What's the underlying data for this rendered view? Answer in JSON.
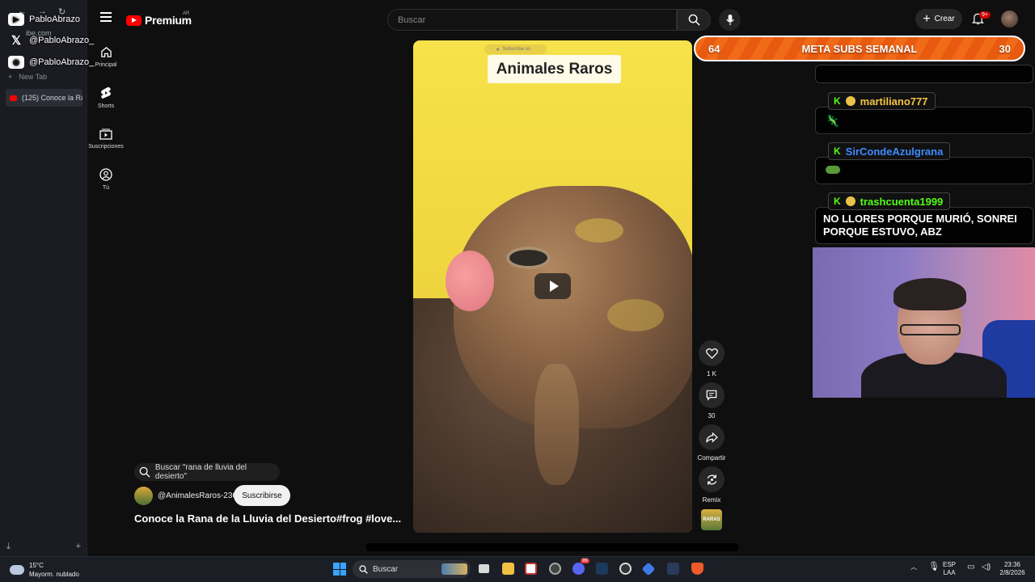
{
  "browser": {
    "url_fragment": "ibe.com",
    "new_tab_label": "New Tab",
    "active_tab_title": "(125) Conoce la Ra"
  },
  "socials": [
    {
      "platform": "youtube",
      "handle": "PabloAbrazo"
    },
    {
      "platform": "x",
      "handle": "@PabloAbrazo_"
    },
    {
      "platform": "discord",
      "handle": "@PabloAbrazo_"
    }
  ],
  "youtube": {
    "logo_text": "Premium",
    "region": "AR",
    "search_placeholder": "Buscar",
    "create_label": "Crear",
    "notification_badge": "9+",
    "nav": [
      {
        "label": "Principal",
        "icon": "home-icon"
      },
      {
        "label": "Shorts",
        "icon": "shorts-icon"
      },
      {
        "label": "Suscripciones",
        "icon": "subscriptions-icon"
      },
      {
        "label": "Tú",
        "icon": "you-icon"
      }
    ]
  },
  "short": {
    "overlay_subscribe": "Subscribe us",
    "overlay_title": "Animales Raros",
    "actions": {
      "like_count": "1 K",
      "comment_count": "30",
      "share_label": "Compartir",
      "remix_label": "Remix"
    },
    "channel_thumb_text": "RARAS",
    "related_search": "Buscar \"rana de lluvia del desierto\"",
    "channel_name": "@AnimalesRaros-236",
    "subscribe_label": "Suscribirse",
    "title": "Conoce la Rana de la Lluvia del Desierto#frog #love..."
  },
  "stream": {
    "goal": {
      "current": "64",
      "label": "META SUBS SEMANAL",
      "target": "30"
    },
    "chat": [
      {
        "user": "martiliano777",
        "user_color": "#f5c542",
        "message": ""
      },
      {
        "user": "SirCondeAzulgrana",
        "user_color": "#3d8bff",
        "message": ""
      },
      {
        "user": "trashcuenta1999",
        "user_color": "#53fc18",
        "message": "NO LLORES PORQUE MURIÓ, SONREI PORQUE ESTUVO, ABZ"
      }
    ],
    "kick_letter": "K"
  },
  "taskbar": {
    "temperature": "15°C",
    "weather": "Mayorm. nublado",
    "search_label": "Buscar",
    "discord_badge": "99",
    "lang_top": "ESP",
    "lang_bottom": "LAA",
    "time": "23:36",
    "date": "2/8/2026"
  }
}
